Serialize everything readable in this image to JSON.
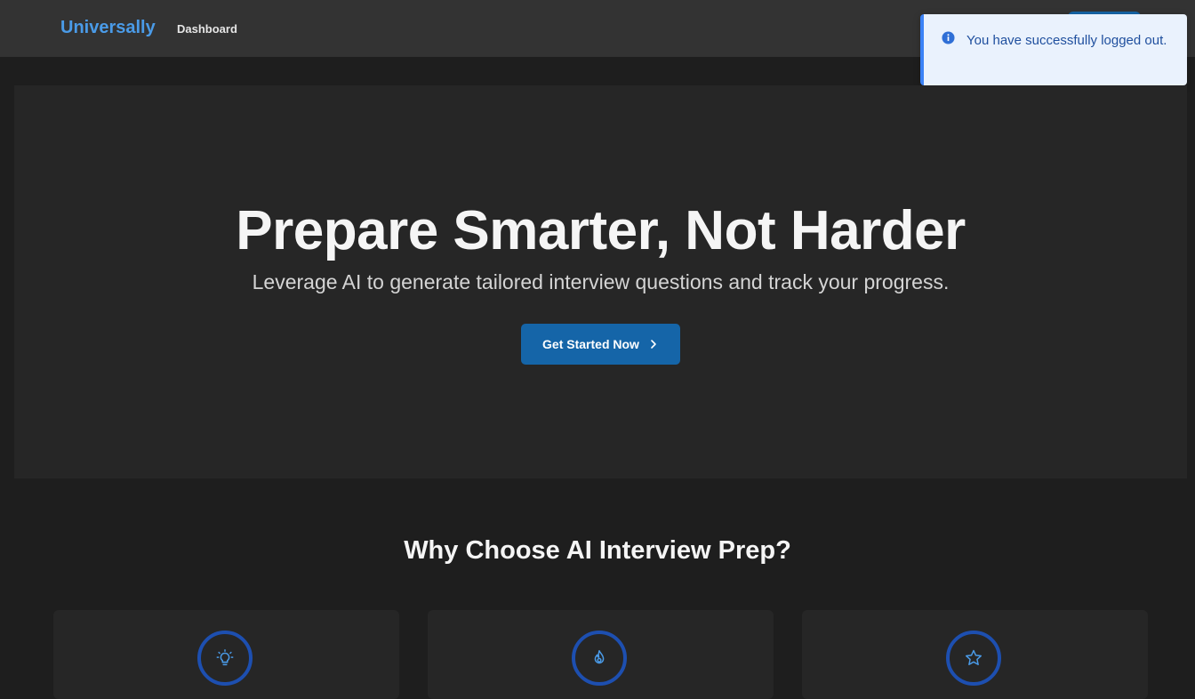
{
  "navbar": {
    "brand": "Universally",
    "links": [
      {
        "label": "Dashboard"
      }
    ]
  },
  "toast": {
    "message": "You have successfully logged out.",
    "icon": "info-icon"
  },
  "hero": {
    "title": "Prepare Smarter, Not Harder",
    "subtitle": "Leverage AI to generate tailored interview questions and track your progress.",
    "cta_label": "Get Started Now",
    "cta_icon": "chevron-right-icon"
  },
  "features": {
    "title": "Why Choose AI Interview Prep?",
    "cards": [
      {
        "icon": "lightbulb-icon"
      },
      {
        "icon": "flame-icon"
      },
      {
        "icon": "star-icon"
      }
    ]
  },
  "colors": {
    "accent": "#1565a8",
    "brand": "#4a9be8",
    "background": "#1e1e1e",
    "navbar": "#333333",
    "toast_bg": "#eaf2fd",
    "toast_text": "#1f4f9e",
    "icon_ring": "#1d4fb0"
  }
}
